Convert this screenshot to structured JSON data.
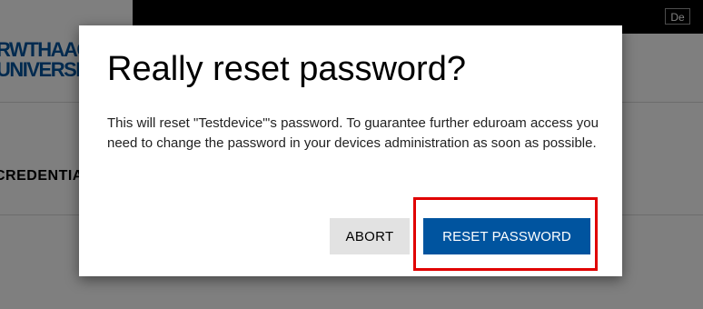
{
  "header": {
    "language_button": "De"
  },
  "logo": {
    "line1": "RWTHAACHEN",
    "line2": "UNIVERSITY"
  },
  "background": {
    "section_heading": "CREDENTIALS"
  },
  "dialog": {
    "title": "Really reset password?",
    "message": "This will reset \"Testdevice\"'s password. To guarantee further eduroam access you need to change the password in your devices administration as soon as possible.",
    "abort_label": "ABORT",
    "reset_label": "RESET PASSWORD"
  },
  "colors": {
    "brand_blue": "#00549f",
    "highlight_red": "#e00000",
    "abort_gray": "#e2e2e2"
  }
}
